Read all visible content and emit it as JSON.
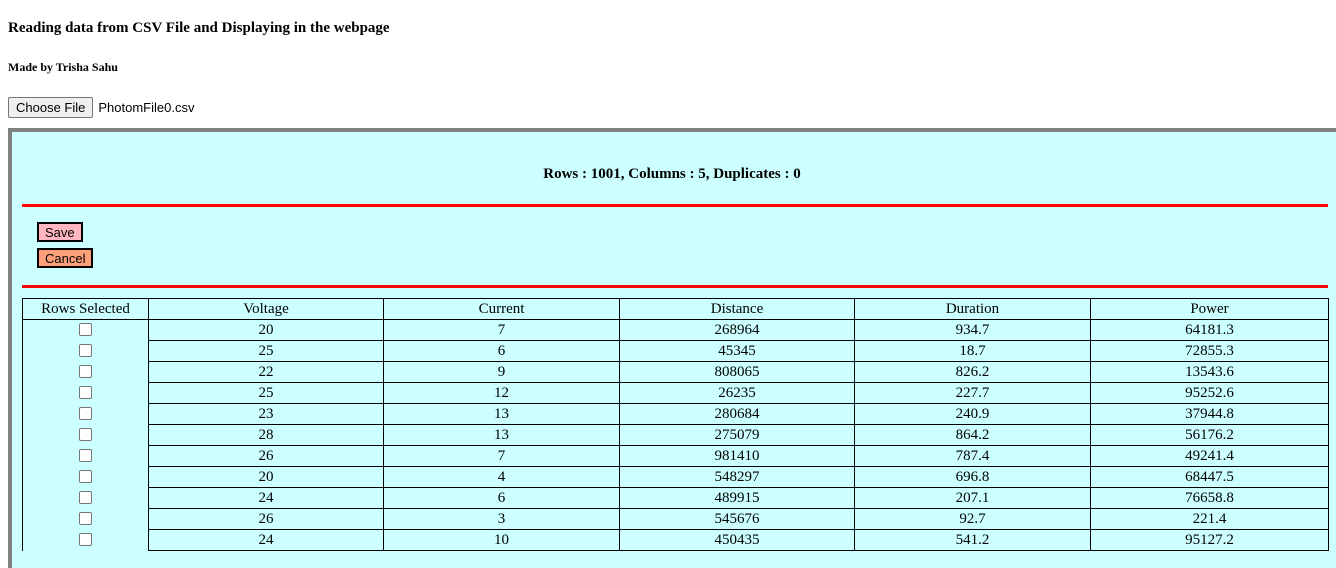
{
  "header": {
    "title": "Reading data from CSV File and Displaying in the webpage",
    "author": "Made by Trisha Sahu"
  },
  "file_input": {
    "button_label": "Choose File",
    "file_name": "PhotomFile0.csv"
  },
  "summary": {
    "text": "Rows : 1001, Columns : 5, Duplicates : 0"
  },
  "actions": {
    "save_label": "Save",
    "cancel_label": "Cancel"
  },
  "colors": {
    "panel_bg": "#ccffff",
    "rule": "#ff0000",
    "save_bg": "#ffb6c1",
    "cancel_bg": "#ffa07a"
  },
  "table": {
    "selection_header": "Rows Selected",
    "columns": [
      "Voltage",
      "Current",
      "Distance",
      "Duration",
      "Power"
    ],
    "rows": [
      [
        "20",
        "7",
        "268964",
        "934.7",
        "64181.3"
      ],
      [
        "25",
        "6",
        "45345",
        "18.7",
        "72855.3"
      ],
      [
        "22",
        "9",
        "808065",
        "826.2",
        "13543.6"
      ],
      [
        "25",
        "12",
        "26235",
        "227.7",
        "95252.6"
      ],
      [
        "23",
        "13",
        "280684",
        "240.9",
        "37944.8"
      ],
      [
        "28",
        "13",
        "275079",
        "864.2",
        "56176.2"
      ],
      [
        "26",
        "7",
        "981410",
        "787.4",
        "49241.4"
      ],
      [
        "20",
        "4",
        "548297",
        "696.8",
        "68447.5"
      ],
      [
        "24",
        "6",
        "489915",
        "207.1",
        "76658.8"
      ],
      [
        "26",
        "3",
        "545676",
        "92.7",
        "221.4"
      ],
      [
        "24",
        "10",
        "450435",
        "541.2",
        "95127.2"
      ]
    ]
  }
}
